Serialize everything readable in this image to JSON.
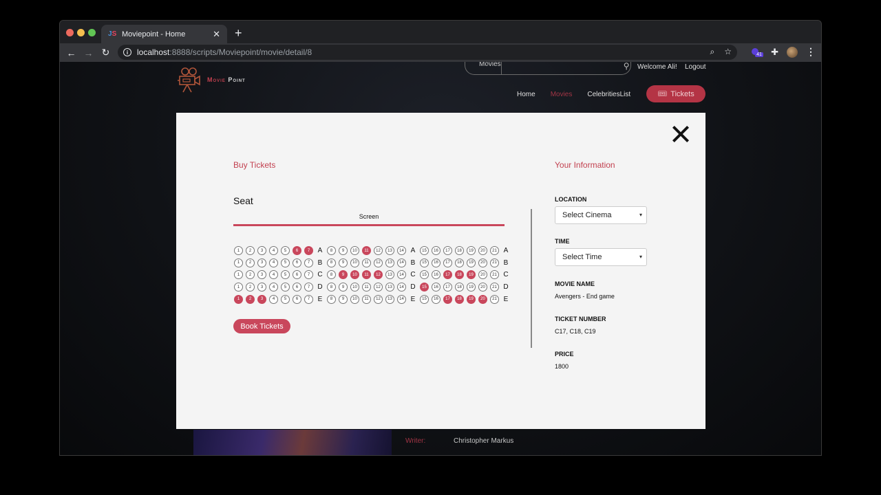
{
  "browser": {
    "tab_title": "Moviepoint - Home",
    "favicon": "JS",
    "url_host": "localhost",
    "url_path": ":8888/scripts/Moviepoint/movie/detail/8",
    "extension_badge": "41"
  },
  "header": {
    "logo_text_1": "Movie",
    "logo_text_2": "Point",
    "search_category": "Movies",
    "search_placeholder": "",
    "welcome": "Welcome Ali!",
    "logout": "Logout",
    "nav": [
      "Home",
      "Movies",
      "CelebritiesList"
    ],
    "active_nav": "Movies",
    "tickets_button": "Tickets"
  },
  "modal": {
    "buy_title": "Buy Tickets",
    "seat_label": "Seat",
    "screen_label": "Screen",
    "rows": [
      "A",
      "B",
      "C",
      "D",
      "E"
    ],
    "seat_numbers_block1": [
      1,
      2,
      3,
      4,
      5,
      6,
      7
    ],
    "seat_numbers_block2": [
      8,
      9,
      10,
      11,
      12,
      13,
      14
    ],
    "seat_numbers_block3": [
      15,
      16,
      17,
      18,
      19,
      20,
      21
    ],
    "booked": {
      "A": [
        6,
        7,
        11
      ],
      "B": [],
      "C": [
        9,
        10,
        11,
        12,
        17,
        18,
        19
      ],
      "D": [
        15
      ],
      "E": [
        1,
        2,
        3,
        17,
        18,
        19,
        20
      ]
    },
    "book_button": "Book Tickets",
    "info_title": "Your Information",
    "location_label": "LOCATION",
    "location_value": "Select Cinema",
    "time_label": "TIME",
    "time_value": "Select Time",
    "movie_name_label": "MOVIE NAME",
    "movie_name": "Avengers - End game",
    "ticket_number_label": "TICKET NUMBER",
    "ticket_number": "C17, C18, C19",
    "price_label": "PRICE",
    "price": "1800"
  },
  "background_page": {
    "writer_label": "Writer:",
    "writer_value": "Christopher Markus"
  },
  "colors": {
    "accent": "#c9475c",
    "title_red": "#c2404f",
    "modal_bg": "#f4f4f4"
  }
}
